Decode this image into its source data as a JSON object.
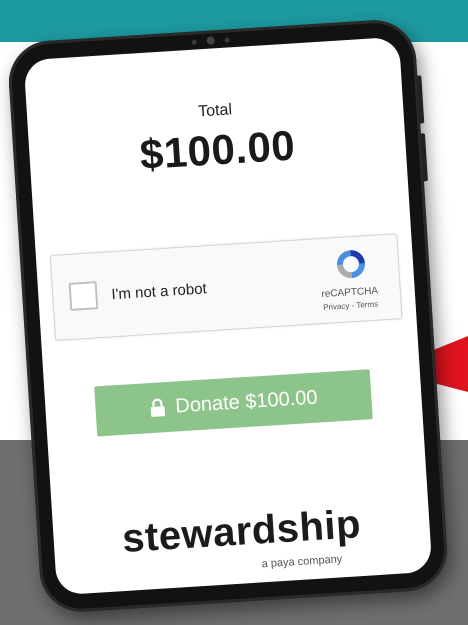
{
  "payment": {
    "total_label": "Total",
    "total_amount": "$100.00"
  },
  "captcha": {
    "label": "I'm not a robot",
    "brand": "reCAPTCHA",
    "links": "Privacy - Terms",
    "checked": false
  },
  "donate_button": {
    "label": "Donate $100.00",
    "icon": "lock-icon"
  },
  "brand": {
    "name": "stewardship",
    "tagline": "a paya company"
  },
  "colors": {
    "teal_band": "#1d9aa0",
    "gray_band": "#6f6f6f",
    "donate_green": "#8cc48a",
    "arrow_red": "#e0141e"
  }
}
